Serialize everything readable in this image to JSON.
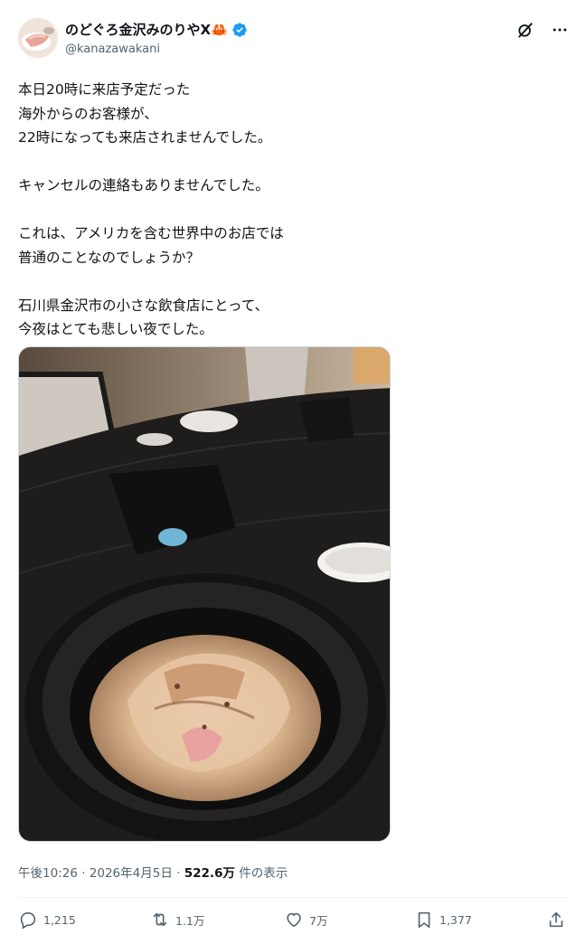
{
  "post": {
    "author": {
      "display_name": "のどぐろ金沢みのりやX🦀",
      "handle": "@kanazawakani",
      "verified": true,
      "avatar_icon": "avatar-food-photo"
    },
    "lines": [
      "本日20時に来店予定だった",
      "海外からのお客様が、",
      "22時になっても来店されませんでした。",
      "",
      "キャンセルの連絡もありませんでした。",
      "",
      "これは、アメリカを含む世界中のお店では",
      "普通のことなのでしょうか？",
      "",
      "石川県金沢市の小さな飲食店にとって、",
      "今夜はとても悲しい夜でした。"
    ],
    "meta": {
      "time": "午後10:26",
      "sep1": " · ",
      "date": "2026年4月5日",
      "sep2": " · ",
      "views": "522.6万",
      "views_suffix": " 件の表示"
    },
    "stats": {
      "replies": "1,215",
      "reposts": "1.1万",
      "likes": "7万",
      "bookmarks": "1,377"
    }
  },
  "icons": {
    "grok": "grok-icon",
    "more": "more-icon",
    "reply": "reply-icon",
    "repost": "repost-icon",
    "like": "heart-icon",
    "bookmark": "bookmark-icon",
    "share": "share-icon"
  },
  "colors": {
    "verified": "#1d9bf0",
    "text": "#0f1419",
    "secondary": "#536471"
  }
}
